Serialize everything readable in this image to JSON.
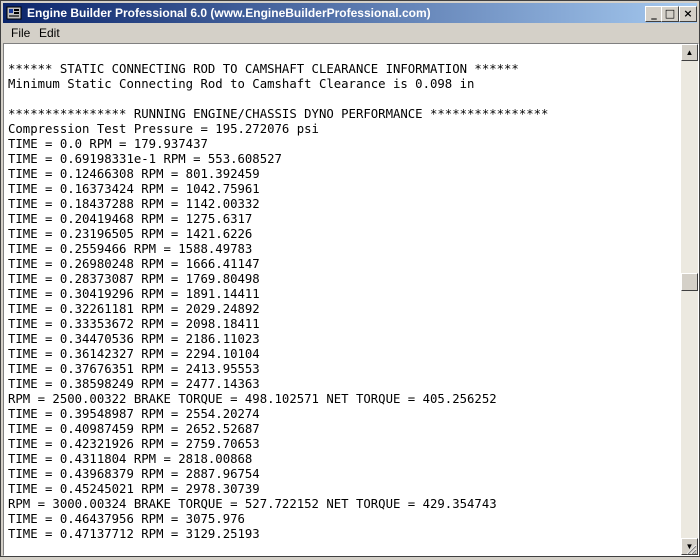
{
  "window": {
    "title": "Engine Builder Professional 6.0  (www.EngineBuilderProfessional.com)",
    "minimize_glyph": "_",
    "maximize_glyph": "□",
    "close_glyph": "×"
  },
  "menu": {
    "items": [
      {
        "label": "File"
      },
      {
        "label": "Edit"
      }
    ]
  },
  "output": {
    "lines": [
      "",
      "****** STATIC CONNECTING ROD TO CAMSHAFT CLEARANCE INFORMATION ******",
      "Minimum Static Connecting Rod to Camshaft Clearance is 0.098 in",
      "",
      "**************** RUNNING ENGINE/CHASSIS DYNO PERFORMANCE ****************",
      "Compression Test Pressure = 195.272076 psi",
      "TIME = 0.0 RPM = 179.937437",
      "TIME = 0.69198331e-1 RPM = 553.608527",
      "TIME = 0.12466308 RPM = 801.392459",
      "TIME = 0.16373424 RPM = 1042.75961",
      "TIME = 0.18437288 RPM = 1142.00332",
      "TIME = 0.20419468 RPM = 1275.6317",
      "TIME = 0.23196505 RPM = 1421.6226",
      "TIME = 0.2559466 RPM = 1588.49783",
      "TIME = 0.26980248 RPM = 1666.41147",
      "TIME = 0.28373087 RPM = 1769.80498",
      "TIME = 0.30419296 RPM = 1891.14411",
      "TIME = 0.32261181 RPM = 2029.24892",
      "TIME = 0.33353672 RPM = 2098.18411",
      "TIME = 0.34470536 RPM = 2186.11023",
      "TIME = 0.36142327 RPM = 2294.10104",
      "TIME = 0.37676351 RPM = 2413.95553",
      "TIME = 0.38598249 RPM = 2477.14363",
      "RPM = 2500.00322 BRAKE TORQUE = 498.102571 NET TORQUE = 405.256252",
      "TIME = 0.39548987 RPM = 2554.20274",
      "TIME = 0.40987459 RPM = 2652.52687",
      "TIME = 0.42321926 RPM = 2759.70653",
      "TIME = 0.4311804 RPM = 2818.00868",
      "TIME = 0.43968379 RPM = 2887.96754",
      "TIME = 0.45245021 RPM = 2978.30739",
      "RPM = 3000.00324 BRAKE TORQUE = 527.722152 NET TORQUE = 429.354743",
      "TIME = 0.46437956 RPM = 3075.976",
      "TIME = 0.47137712 RPM = 3129.25193"
    ]
  },
  "scrollbar": {
    "up_glyph": "▲",
    "down_glyph": "▼",
    "position_fraction": 0.46
  },
  "colors": {
    "titlebar_start": "#0a246a",
    "titlebar_end": "#a6caf0",
    "chrome": "#d4d0c8",
    "text_bg": "#ffffff"
  }
}
